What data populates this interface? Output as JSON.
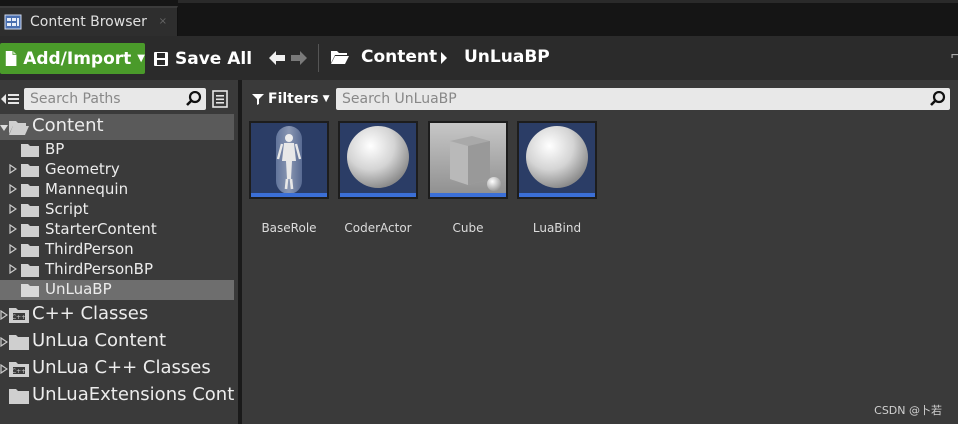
{
  "tab": {
    "title": "Content Browser",
    "close_icon": "×"
  },
  "toolbar": {
    "add_import_label": "Add/Import",
    "save_all_label": "Save All",
    "breadcrumb": [
      "Content",
      "UnLuaBP"
    ]
  },
  "sources": {
    "search_placeholder": "Search Paths",
    "tree": [
      {
        "label": "Content",
        "level": 0,
        "expanded": true,
        "icon": "folder-open-icon"
      },
      {
        "label": "BP",
        "level": 1,
        "has_children": false,
        "icon": "folder-icon"
      },
      {
        "label": "Geometry",
        "level": 1,
        "has_children": true,
        "icon": "folder-icon"
      },
      {
        "label": "Mannequin",
        "level": 1,
        "has_children": true,
        "icon": "folder-icon"
      },
      {
        "label": "Script",
        "level": 1,
        "has_children": true,
        "icon": "folder-icon"
      },
      {
        "label": "StarterContent",
        "level": 1,
        "has_children": true,
        "icon": "folder-icon"
      },
      {
        "label": "ThirdPerson",
        "level": 1,
        "has_children": true,
        "icon": "folder-icon"
      },
      {
        "label": "ThirdPersonBP",
        "level": 1,
        "has_children": true,
        "icon": "folder-icon"
      },
      {
        "label": "UnLuaBP",
        "level": 1,
        "has_children": false,
        "selected": true,
        "icon": "folder-icon"
      },
      {
        "label": "C++ Classes",
        "level": 0,
        "has_children": true,
        "icon": "cpp-folder-icon"
      },
      {
        "label": "UnLua Content",
        "level": 0,
        "has_children": true,
        "icon": "folder-icon"
      },
      {
        "label": "UnLua C++ Classes",
        "level": 0,
        "has_children": true,
        "icon": "cpp-folder-icon"
      },
      {
        "label": "UnLuaExtensions Cont",
        "level": 0,
        "has_children": false,
        "icon": "folder-icon"
      }
    ]
  },
  "assets": {
    "filters_label": "Filters",
    "search_placeholder": "Search UnLuaBP",
    "items": [
      {
        "name": "BaseRole",
        "thumbnail": "mannequin-capsule-thumbnail"
      },
      {
        "name": "CoderActor",
        "thumbnail": "sphere-thumbnail"
      },
      {
        "name": "Cube",
        "thumbnail": "cube-thumbnail"
      },
      {
        "name": "LuaBind",
        "thumbnail": "sphere-thumbnail"
      }
    ]
  },
  "watermark": "CSDN @卜若",
  "colors": {
    "add_button": "#4a9a2a",
    "thumb_background": "#2b3d66",
    "thumb_bar": "#3b6fd6",
    "selection": "#6e6e6e"
  }
}
